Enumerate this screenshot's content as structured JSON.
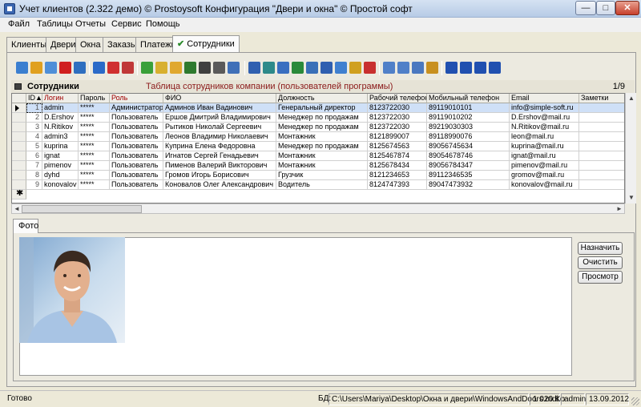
{
  "window": {
    "title": "Учет клиентов (2.322 демо) © Prostoysoft  Конфигурация \"Двери и окна\" © Простой софт",
    "min_glyph": "—",
    "max_glyph": "□",
    "close_glyph": "✕"
  },
  "menu": [
    "Файл",
    "Таблицы",
    "Отчеты",
    "Сервис",
    "Помощь"
  ],
  "tabs": [
    "Клиенты",
    "Двери",
    "Окна",
    "Заказы",
    "Платежи",
    "Сотрудники"
  ],
  "active_tab_check": "✔",
  "grid": {
    "name": "Сотрудники",
    "description": "Таблица сотрудников компании (пользователей программы)",
    "position": "1/9",
    "columns": [
      "ID",
      "Логин",
      "Пароль",
      "Роль",
      "ФИО",
      "Должность",
      "Рабочий телефон",
      "Мобильный телефон",
      "Email",
      "Заметки"
    ],
    "rows": [
      {
        "id": "1",
        "login": "admin",
        "password": "*****",
        "role": "Администратор",
        "fio": "Админов Иван Вадинович",
        "position": "Генеральный директор",
        "work_phone": "8123722030",
        "mobile": "89119010101",
        "email": "info@simple-soft.ru",
        "notes": ""
      },
      {
        "id": "2",
        "login": "D.Ershov",
        "password": "*****",
        "role": "Пользователь",
        "fio": "Ершов Дмитрий Владимирович",
        "position": "Менеджер по продажам",
        "work_phone": "8123722030",
        "mobile": "89119010202",
        "email": "D.Ershov@mail.ru",
        "notes": ""
      },
      {
        "id": "3",
        "login": "N.Ritikov",
        "password": "*****",
        "role": "Пользователь",
        "fio": "Рытиков Николай Сергеевич",
        "position": "Менеджер по продажам",
        "work_phone": "8123722030",
        "mobile": "89219030303",
        "email": "N.Ritikov@mail.ru",
        "notes": ""
      },
      {
        "id": "4",
        "login": "admin3",
        "password": "*****",
        "role": "Пользователь",
        "fio": "Леонов Владимир Николаевич",
        "position": "Монтажник",
        "work_phone": "8121899007",
        "mobile": "89118990076",
        "email": "leon@mail.ru",
        "notes": ""
      },
      {
        "id": "5",
        "login": "kuprina",
        "password": "*****",
        "role": "Пользователь",
        "fio": "Куприна Елена Федоровна",
        "position": "Менеджер по продажам",
        "work_phone": "8125674563",
        "mobile": "89056745634",
        "email": "kuprina@mail.ru",
        "notes": ""
      },
      {
        "id": "6",
        "login": "ignat",
        "password": "*****",
        "role": "Пользователь",
        "fio": "Игнатов Сергей Генадьевич",
        "position": "Монтажник",
        "work_phone": "8125467874",
        "mobile": "89054678746",
        "email": "ignat@mail.ru",
        "notes": ""
      },
      {
        "id": "7",
        "login": "pimenov",
        "password": "*****",
        "role": "Пользователь",
        "fio": "Пименов Валерий Викторович",
        "position": "Монтажник",
        "work_phone": "8125678434",
        "mobile": "89056784347",
        "email": "pimenov@mail.ru",
        "notes": ""
      },
      {
        "id": "8",
        "login": "dyhd",
        "password": "*****",
        "role": "Пользователь",
        "fio": "Громов Игорь Борисович",
        "position": "Грузчик",
        "work_phone": "8121234653",
        "mobile": "89112346535",
        "email": "gromov@mail.ru",
        "notes": ""
      },
      {
        "id": "9",
        "login": "konovalov",
        "password": "*****",
        "role": "Пользователь",
        "fio": "Коновалов Олег Александрович",
        "position": "Водитель",
        "work_phone": "8124747393",
        "mobile": "89047473932",
        "email": "konovalov@mail.ru",
        "notes": ""
      }
    ],
    "new_row_marker": "✱"
  },
  "photo_section": {
    "tab_label": "Фото",
    "buttons": [
      "Назначить",
      "Очистить",
      "Просмотр"
    ]
  },
  "status": {
    "state": "Готово",
    "db_label": "БД:",
    "db_path": "C:\\Users\\Mariya\\Desktop\\Окна и двери\\WindowsAndDoors.mdb",
    "db_size": "1 020 Kb",
    "user": "admin",
    "date": "13.09.2012"
  },
  "colors": {
    "selected_row": "#cfe0f7",
    "header_required": "#a00000",
    "grid_description": "#8b1a1a"
  },
  "toolbar_icons": [
    "new-record-icon",
    "edit-record-icon",
    "copy-record-icon",
    "delete-record-icon",
    "refresh-icon",
    "filter-icon",
    "filter-apply-icon",
    "filter-clear-icon",
    "recycle-icon",
    "group-icon",
    "find-replace-icon",
    "find-icon",
    "print-icon",
    "preview-icon",
    "export-icon",
    "import-icon",
    "send-icon",
    "excel-icon",
    "sql-icon",
    "word-icon",
    "chart-icon",
    "sort-asc-icon",
    "sort-desc-icon",
    "table-icon",
    "settings-icon",
    "first-record-icon",
    "prev-record-icon",
    "next-record-icon",
    "last-record-icon"
  ]
}
